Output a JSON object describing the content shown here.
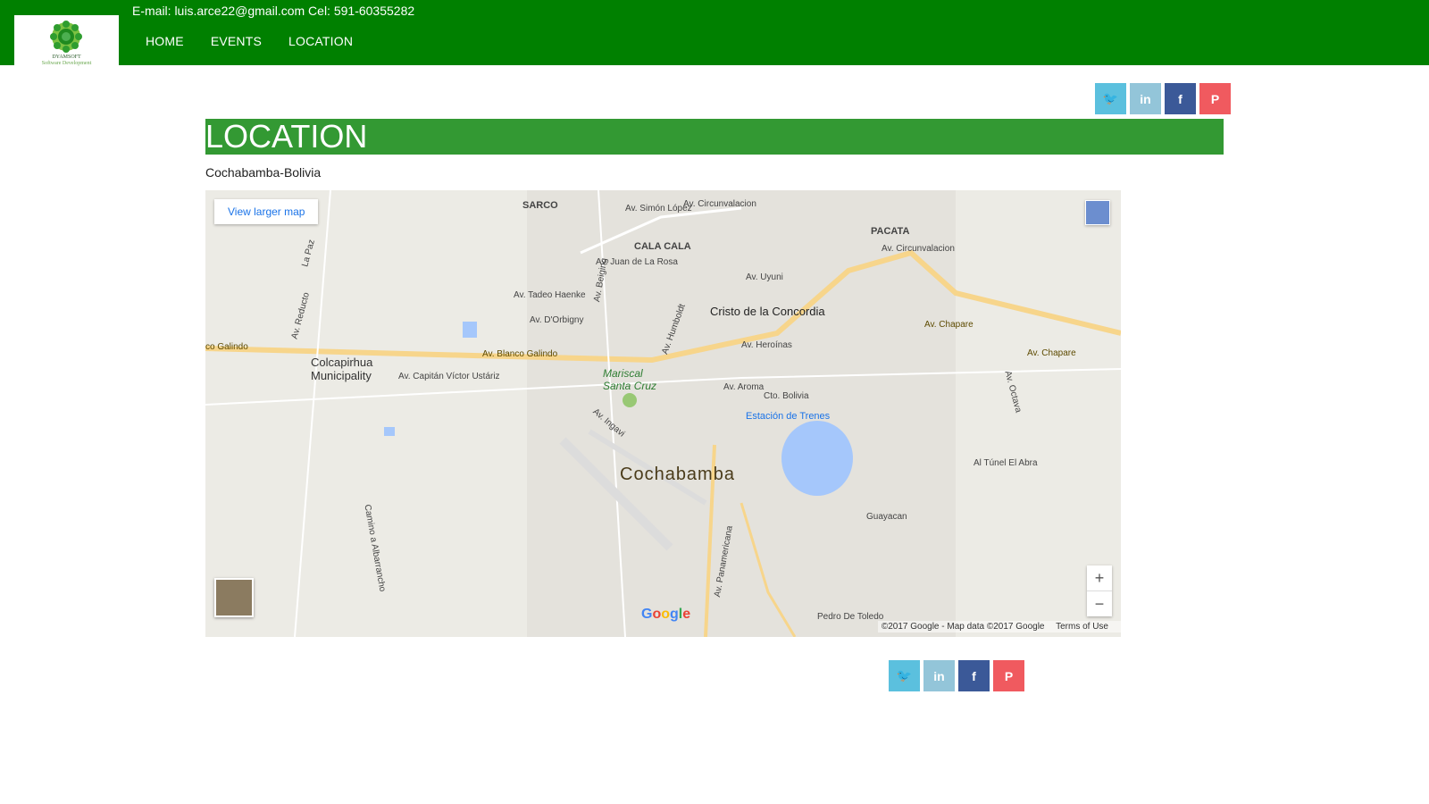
{
  "header": {
    "contact": "E-mail: luis.arce22@gmail.com Cel: 591-60355282",
    "logo_title": "DYAMSOFT",
    "logo_subtitle": "Software Development",
    "nav": [
      "HOME",
      "EVENTS",
      "LOCATION"
    ]
  },
  "share_icons": [
    "twitter-icon",
    "linkedin-icon",
    "facebook-icon",
    "pinterest-icon"
  ],
  "share_glyphs": [
    "🐦",
    "in",
    "f",
    "P"
  ],
  "page": {
    "title": "LOCATION",
    "subtitle": "Cochabamba-Bolivia"
  },
  "map": {
    "view_larger": "View larger map",
    "city": "Cochabamba",
    "landmark": "Cristo de la Concordia",
    "station": "Estación de Trenes",
    "park": "Mariscal Santa Cruz",
    "municipality": "Colcapirhua Municipality",
    "labels": {
      "sarco": "SARCO",
      "cala_cala": "CALA CALA",
      "pacata": "PACATA",
      "av_circunvalacion_a": "Av. Circunvalacion",
      "av_circunvalacion_b": "Av. Circunvalacion",
      "av_simon_lopez": "Av. Simón López",
      "av_juan_rosa": "Av. Juan de La Rosa",
      "av_uyuni": "Av. Uyuni",
      "av_tadeo_haenke": "Av. Tadeo Haenke",
      "av_dorbigny": "Av. D'Orbigny",
      "av_blanco_galindo": "Av. Blanco Galindo",
      "co_galindo": "co Galindo",
      "av_capitan": "Av. Capitán Víctor Ustáriz",
      "av_heroinas": "Av. Heroínas",
      "av_aroma": "Av. Aroma",
      "av_chapare_a": "Av. Chapare",
      "av_chapare_b": "Av. Chapare",
      "av_tunel": "Al Túnel El Abra",
      "guayacan": "Guayacan",
      "av_panamericana": "Av. Panamericana",
      "pedro_toledo": "Pedro De Toledo",
      "av_reducto": "Av. Reducto",
      "la_paz": "La Paz",
      "av_octava": "Av. Octava",
      "av_ingavi": "Av. Ingavi",
      "camino_albarrancho": "Camino a Albarrancho",
      "av_humboldt": "Av. Humboldt",
      "av_beigin": "Av. Beiging",
      "cto_bolivia": "Cto. Bolivia"
    },
    "zoom_in": "+",
    "zoom_out": "−",
    "google": "Google",
    "attribution": "©2017 Google - Map data ©2017 Google",
    "terms": "Terms of Use"
  }
}
